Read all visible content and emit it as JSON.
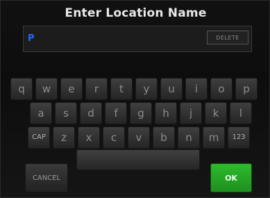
{
  "header": {
    "title": "Enter Location Name"
  },
  "input": {
    "value": "P",
    "delete_label": "DELETE",
    "value_color": "#1e6bff"
  },
  "keyboard": {
    "row1": [
      "q",
      "w",
      "e",
      "r",
      "t",
      "y",
      "u",
      "i",
      "o",
      "p"
    ],
    "row2": [
      "a",
      "s",
      "d",
      "f",
      "g",
      "h",
      "j",
      "k",
      "l"
    ],
    "row3": [
      "CAP",
      "z",
      "x",
      "c",
      "v",
      "b",
      "n",
      "m",
      "123"
    ]
  },
  "actions": {
    "cancel_label": "CANCEL",
    "ok_label": "OK",
    "ok_color": "#22a822"
  }
}
